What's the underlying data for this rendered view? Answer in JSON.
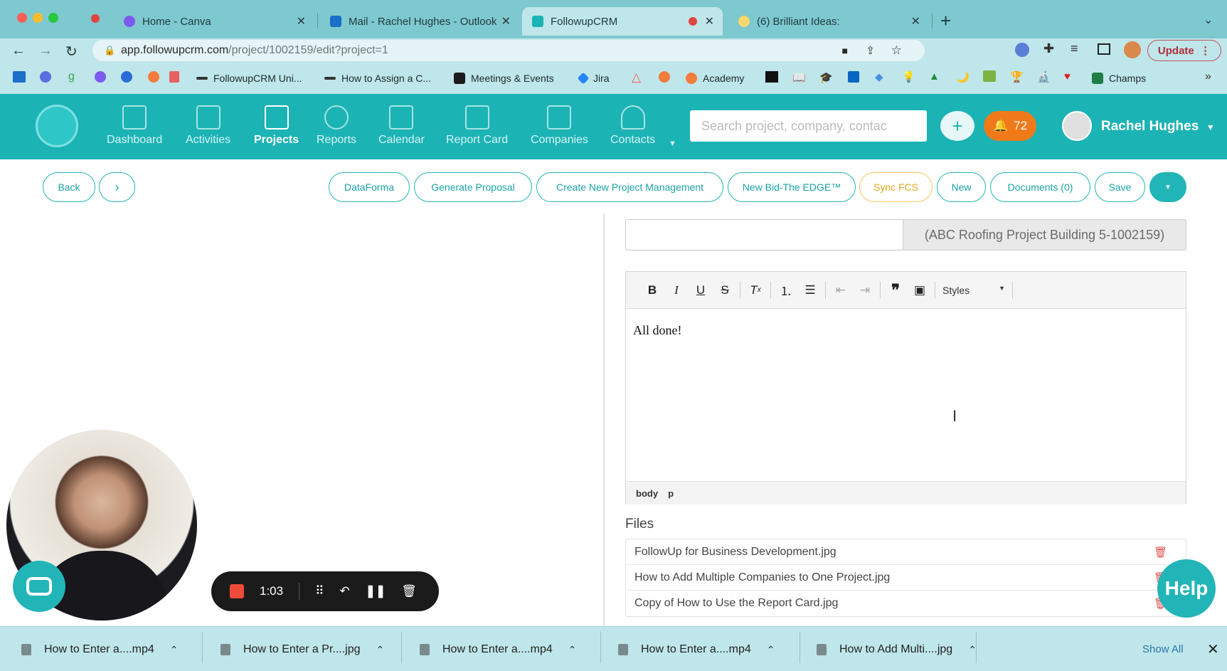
{
  "browser": {
    "tabs": [
      {
        "label": "Home - Canva",
        "icon": "canva-icon"
      },
      {
        "label": "Mail - Rachel Hughes - Outlook",
        "icon": "outlook-icon"
      },
      {
        "label": "FollowupCRM",
        "icon": "followupcrm-icon"
      },
      {
        "label": "(6) Brilliant Ideas:",
        "icon": "lightbulb-icon"
      }
    ],
    "url_host": "app.followupcrm.com",
    "url_path": "/project/1002159/edit?project=1",
    "update_label": "Update",
    "bookmarks": [
      "FollowupCRM Uni...",
      "How to Assign a C...",
      "Meetings & Events",
      "Jira",
      "Academy",
      "Champs"
    ]
  },
  "appnav": {
    "items": [
      "Dashboard",
      "Activities",
      "Projects",
      "Reports",
      "Calendar",
      "Report Card",
      "Companies",
      "Contacts"
    ],
    "active": "Projects",
    "search_placeholder": "Search project, company, contac",
    "notifications": "72",
    "user": "Rachel Hughes"
  },
  "actions": {
    "back": "Back",
    "next": "›",
    "buttons": [
      "DataForma",
      "Generate Proposal",
      "Create New Project Management",
      "New Bid-The EDGE™",
      "Sync FCS",
      "New",
      "Documents (0)",
      "Save"
    ]
  },
  "form": {
    "project_suffix": "(ABC Roofing Project Building 5-1002159)",
    "editor_content": "All done!",
    "styles_label": "Styles",
    "path": [
      "body",
      "p"
    ],
    "files_label": "Files",
    "files": [
      "FollowUp for Business Development.jpg",
      "How to Add Multiple Companies to One Project.jpg",
      "Copy of How to Use the Report Card.jpg"
    ]
  },
  "recorder": {
    "time": "1:03"
  },
  "help_label": "Help",
  "downloads": {
    "items": [
      "How to Enter a....mp4",
      "How to Enter a Pr....jpg",
      "How to Enter a....mp4",
      "How to Enter a....mp4",
      "How to Add Multi....jpg"
    ],
    "show_all": "Show All"
  },
  "colors": {
    "brand": "#1cb3b5",
    "notif": "#f07a1a",
    "browser": "#7ec8cf"
  }
}
